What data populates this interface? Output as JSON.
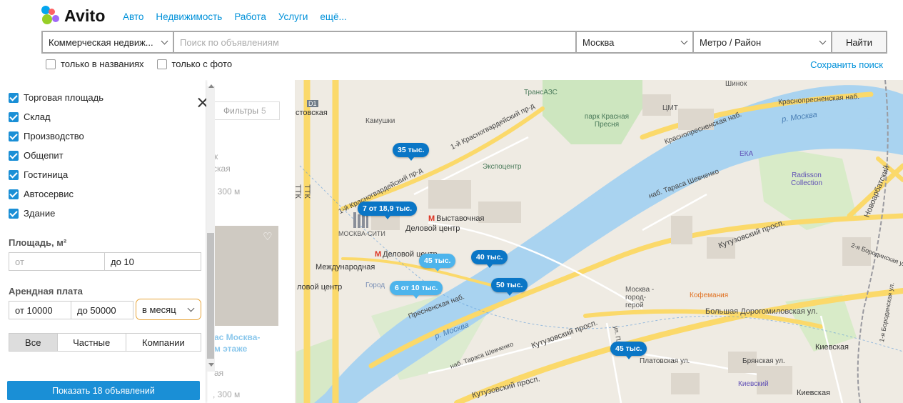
{
  "brand": {
    "name": "Avito",
    "dot_colors": [
      "#04a6ef",
      "#97cf26",
      "#ff6163",
      "#a169f7"
    ]
  },
  "topnav": [
    "Авто",
    "Недвижимость",
    "Работа",
    "Услуги",
    "ещё..."
  ],
  "search": {
    "category": "Коммерческая недвиж...",
    "query_placeholder": "Поиск по объявлениям",
    "city": "Москва",
    "metro": "Метро / Район",
    "find_button": "Найти",
    "options": [
      "только в названиях",
      "только с фото"
    ],
    "save_link": "Сохранить поиск"
  },
  "filter": {
    "types": [
      "Торговая площадь",
      "Склад",
      "Производство",
      "Общепит",
      "Гостиница",
      "Автосервис",
      "Здание"
    ],
    "area": {
      "label": "Площадь, м²",
      "from_placeholder": "от",
      "to_value": "до 10"
    },
    "rent": {
      "label": "Арендная плата",
      "from_value": "от 10000",
      "to_value": "до 50000",
      "period": "в месяц"
    },
    "seller_tabs": [
      "Все",
      "Частные",
      "Компании"
    ],
    "seller_selected": "Все",
    "show_button": "Показать 18 объявлений"
  },
  "listing": {
    "filters_label": "Фильтры",
    "filters_count": "5",
    "snippets": [
      "к",
      "ская",
      ", 300 м",
      "ас Москва-",
      "м этаже",
      "ая",
      ", 300 м"
    ]
  },
  "map": {
    "accent": "#0a76c6",
    "price_pins": [
      {
        "label": "35 тыс."
      },
      {
        "label": "7 от 18,9 тыс."
      },
      {
        "label": "45 тыс."
      },
      {
        "label": "40 тыс."
      },
      {
        "label": "6 от 10 тыс."
      },
      {
        "label": "50 тыс."
      },
      {
        "label": "45 тыс."
      }
    ],
    "labels": {
      "kamushki": "Камушки",
      "krasnogv1": "1-й Красногвардейский пр-д",
      "krasnogv2": "1-й Красногвардейский пр-д",
      "expocentre": "Экспоцентр",
      "vystavochnaya": "Выставочная",
      "delovoy_centr": "Деловой центр",
      "delovoy_centr2": "Деловой центр",
      "moskva_city": "МОСКВА-СИТИ",
      "mezhdunarodnaya": "Международная",
      "delovoy_centr3": "ловой центр",
      "gorod_stolits": "Город",
      "presnenskaya": "Пресненская наб.",
      "reka1": "р. Москва",
      "reka2": "р. Москва",
      "transaz": "ТрансАЗС",
      "park": "парк Красная Пресня",
      "cmt": "ЦМТ",
      "shinok": "Шинок",
      "krasnopresn1": "Краснопресненская наб.",
      "krasnopresn2": "Краснопресненская наб.",
      "eka": "ЕКА",
      "radisson": "Radisson Collection",
      "novoarbat": "Новоарбатский",
      "tarasa1": "наб. Тараса Шевченко",
      "tarasa2": "наб. Тараса Шевченко",
      "kutuz1": "Кутузовский просп.",
      "kutuz2": "Кутузовский просп.",
      "kutuz3": "Кутузовский просп.",
      "moskva_gorod_geroy": "Москва - город-герой",
      "kofemania": "Кофемания",
      "bolshaya_dorog": "Большая Дорогомиловская ул.",
      "platovskaya": "Платовская ул.",
      "bryanskaya": "Брянская ул.",
      "kievskaya1": "Киевская",
      "kievskaya2": "Киевская",
      "kievskiy": "Киевский",
      "ttk1": "ТТК",
      "ttk2": "ТТК",
      "stovskaya": "стовская",
      "borod2": "2-я Бородинская ул.",
      "borod1": "1-я Бородинская ул.",
      "ul_pl": "ул. Пл",
      "d1": "D1"
    }
  }
}
